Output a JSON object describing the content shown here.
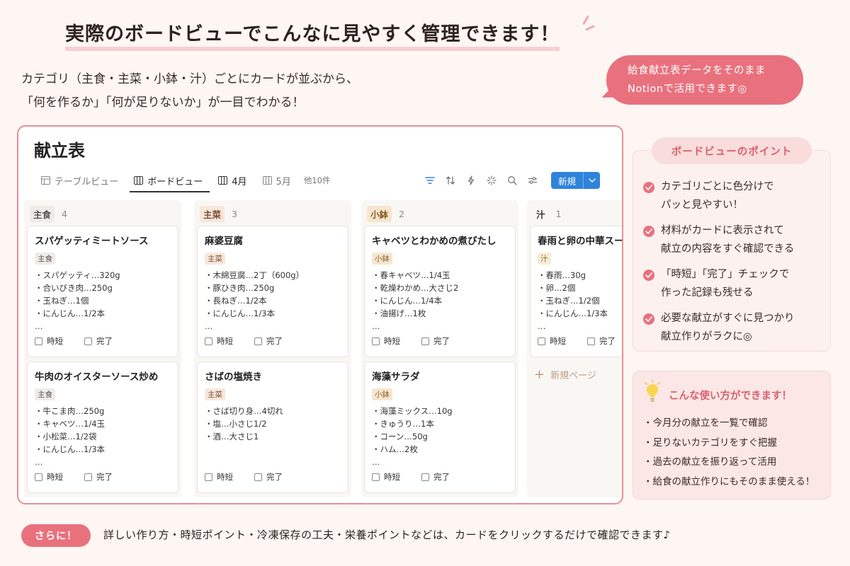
{
  "headline": {
    "part1": "実際のボードビュー",
    "part2": "でこんなに見やすく管理できます！"
  },
  "subtext": {
    "line1": "カテゴリ（主食・主菜・小鉢・汁）ごとにカードが並ぶから、",
    "line2": "「何を作るか」「何が足りないか」が一目でわかる！"
  },
  "bubble": {
    "line1": "給食献立表データをそのまま",
    "line2": "Notionで活用できます◎"
  },
  "board": {
    "title": "献立表",
    "tabs": [
      {
        "label": "テーブルビュー",
        "icon": "table-icon"
      },
      {
        "label": "ボードビュー",
        "icon": "board-icon"
      },
      {
        "label": "4月",
        "icon": "calendar-icon"
      },
      {
        "label": "5月",
        "icon": "calendar-icon"
      }
    ],
    "more_tabs": "他10件",
    "new_button": "新規",
    "columns": [
      {
        "name": "主食",
        "count": "4",
        "style": "main",
        "cards": [
          {
            "title": "スパゲッティミートソース",
            "tag": "主食",
            "ingredients": [
              "・スパゲッティ…320g",
              "・合いびき肉…250g",
              "・玉ねぎ…1個",
              "・にんじん…1/2本",
              "…"
            ]
          },
          {
            "title": "牛肉のオイスターソース炒め",
            "tag": "主食",
            "ingredients": [
              "・牛こま肉…250g",
              "・キャベツ…1/4玉",
              "・小松菜…1/2袋",
              "・にんじん…1/3本",
              "…"
            ]
          }
        ]
      },
      {
        "name": "主菜",
        "count": "3",
        "style": "side",
        "cards": [
          {
            "title": "麻婆豆腐",
            "tag": "主菜",
            "ingredients": [
              "・木綿豆腐…2丁（600g）",
              "・豚ひき肉…250g",
              "・長ねぎ…1/2本",
              "・にんじん…1/3本",
              "…"
            ]
          },
          {
            "title": "さばの塩焼き",
            "tag": "主菜",
            "ingredients": [
              "・さば切り身…4切れ",
              "・塩…小さじ1/2",
              "・酒…大さじ1"
            ]
          }
        ]
      },
      {
        "name": "小鉢",
        "count": "2",
        "style": "small",
        "cards": [
          {
            "title": "キャベツとわかめの煮びたし",
            "tag": "小鉢",
            "ingredients": [
              "・春キャベツ…1/4玉",
              "・乾燥わかめ…大さじ2",
              "・にんじん…1/4本",
              "・油揚げ…1枚",
              "…"
            ]
          },
          {
            "title": "海藻サラダ",
            "tag": "小鉢",
            "ingredients": [
              "・海藻ミックス…10g",
              "・きゅうり…1本",
              "・コーン…50g",
              "・ハム…2枚",
              "…"
            ]
          }
        ]
      },
      {
        "name": "汁",
        "count": "1",
        "style": "soup",
        "cards": [
          {
            "title": "春雨と卵の中華スープ",
            "tag": "汁",
            "ingredients": [
              "・春雨…30g",
              "・卵…2個",
              "・玉ねぎ…1/2個",
              "・にんじん…1/3本",
              "…"
            ]
          }
        ]
      }
    ],
    "check_labels": {
      "jitan": "時短",
      "kanryo": "完了"
    },
    "new_page": "新規ページ"
  },
  "points": {
    "title": "ボードビューのポイント",
    "items": [
      {
        "line1": "カテゴリごとに色分けで",
        "line2": "パッと見やすい！"
      },
      {
        "line1": "材料がカードに表示されて",
        "line2": "献立の内容をすぐ確認できる"
      },
      {
        "line1": "「時短」「完了」チェックで",
        "line2": "作った記録も残せる"
      },
      {
        "line1": "必要な献立がすぐに見つかり",
        "line2": "献立作りがラクに◎"
      }
    ]
  },
  "usage": {
    "title": "こんな使い方ができます！",
    "items": [
      "・今月分の献立を一覧で確認",
      "・足りないカテゴリをすぐ把握",
      "・過去の献立を振り返って活用",
      "・給食の献立作りにもそのまま使える！"
    ]
  },
  "bottom": {
    "badge": "さらに！",
    "text": "詳しい作り方・時短ポイント・冷凍保存の工夫・栄養ポイントなどは、カードをクリックするだけで確認できます♪"
  },
  "colors": {
    "accent": "#e9717e",
    "border": "#ec8d97",
    "primary_button": "#2f83db"
  }
}
